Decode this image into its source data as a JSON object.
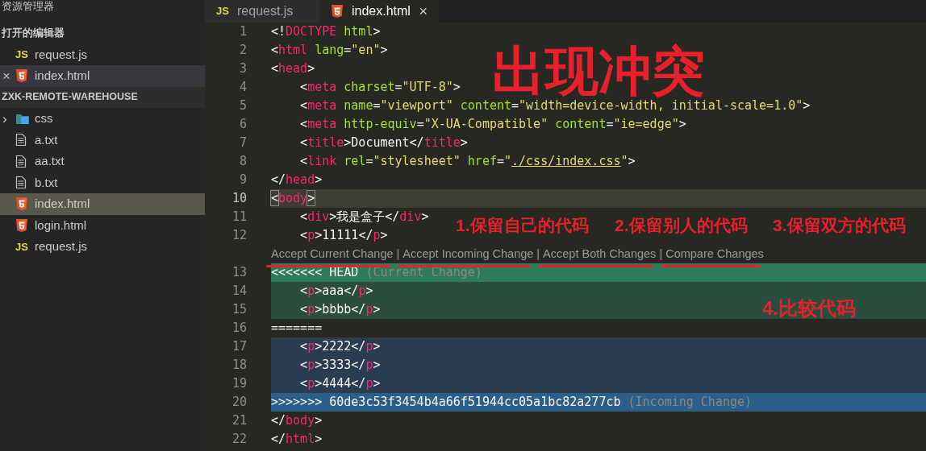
{
  "sidebar": {
    "title": "资源管理器",
    "open_editors": {
      "title": "打开的编辑器",
      "items": [
        {
          "label": "request.js",
          "kind": "js",
          "badge": "JS",
          "selected": false
        },
        {
          "label": "index.html",
          "kind": "html",
          "selected": true,
          "close_glyph": "×"
        }
      ]
    },
    "workspace": {
      "title": "ZXK-REMOTE-WAREHOUSE",
      "items": [
        {
          "label": "css",
          "kind": "folder",
          "expanded": false,
          "chevron": "›",
          "selected": false
        },
        {
          "label": "a.txt",
          "kind": "txt",
          "selected": false
        },
        {
          "label": "aa.txt",
          "kind": "txt",
          "selected": false
        },
        {
          "label": "b.txt",
          "kind": "txt",
          "selected": false
        },
        {
          "label": "index.html",
          "kind": "html",
          "selected": true
        },
        {
          "label": "login.html",
          "kind": "html",
          "selected": false
        },
        {
          "label": "request.js",
          "kind": "js",
          "badge": "JS",
          "selected": false
        }
      ]
    }
  },
  "tabs": [
    {
      "label": "request.js",
      "kind": "js",
      "badge": "JS",
      "selected": false
    },
    {
      "label": "index.html",
      "kind": "html",
      "selected": true,
      "close_glyph": "×"
    }
  ],
  "editor": {
    "lines": [
      {
        "number": "1",
        "kind": "normal",
        "tokens": [
          {
            "kind": "punct",
            "text": "<!"
          },
          {
            "kind": "tag",
            "text": "DOCTYPE"
          },
          {
            "kind": "attr",
            "text": " html"
          },
          {
            "kind": "punct",
            "text": ">"
          }
        ]
      },
      {
        "number": "2",
        "kind": "normal",
        "tokens": [
          {
            "kind": "punct",
            "text": "<"
          },
          {
            "kind": "tag",
            "text": "html"
          },
          {
            "kind": "attr",
            "text": " lang"
          },
          {
            "kind": "punct",
            "text": "="
          },
          {
            "kind": "string",
            "text": "\"en\""
          },
          {
            "kind": "punct",
            "text": ">"
          }
        ]
      },
      {
        "number": "3",
        "kind": "normal",
        "tokens": [
          {
            "kind": "punct",
            "text": "<"
          },
          {
            "kind": "tag",
            "text": "head"
          },
          {
            "kind": "punct",
            "text": ">"
          }
        ]
      },
      {
        "number": "4",
        "kind": "normal",
        "tokens": [
          {
            "kind": "punct",
            "text": "    <"
          },
          {
            "kind": "tag",
            "text": "meta"
          },
          {
            "kind": "attr",
            "text": " charset"
          },
          {
            "kind": "punct",
            "text": "="
          },
          {
            "kind": "string",
            "text": "\"UTF-8\""
          },
          {
            "kind": "punct",
            "text": ">"
          }
        ]
      },
      {
        "number": "5",
        "kind": "normal",
        "tokens": [
          {
            "kind": "punct",
            "text": "    <"
          },
          {
            "kind": "tag",
            "text": "meta"
          },
          {
            "kind": "attr",
            "text": " name"
          },
          {
            "kind": "punct",
            "text": "="
          },
          {
            "kind": "string",
            "text": "\"viewport\""
          },
          {
            "kind": "attr",
            "text": " content"
          },
          {
            "kind": "punct",
            "text": "="
          },
          {
            "kind": "string",
            "text": "\"width=device-width, initial-scale=1.0\""
          },
          {
            "kind": "punct",
            "text": ">"
          }
        ]
      },
      {
        "number": "6",
        "kind": "normal",
        "tokens": [
          {
            "kind": "punct",
            "text": "    <"
          },
          {
            "kind": "tag",
            "text": "meta"
          },
          {
            "kind": "attr",
            "text": " http-equiv"
          },
          {
            "kind": "punct",
            "text": "="
          },
          {
            "kind": "string",
            "text": "\"X-UA-Compatible\""
          },
          {
            "kind": "attr",
            "text": " content"
          },
          {
            "kind": "punct",
            "text": "="
          },
          {
            "kind": "string",
            "text": "\"ie=edge\""
          },
          {
            "kind": "punct",
            "text": ">"
          }
        ]
      },
      {
        "number": "7",
        "kind": "normal",
        "tokens": [
          {
            "kind": "punct",
            "text": "    <"
          },
          {
            "kind": "tag",
            "text": "title"
          },
          {
            "kind": "punct",
            "text": ">"
          },
          {
            "kind": "text",
            "text": "Document"
          },
          {
            "kind": "punct",
            "text": "</"
          },
          {
            "kind": "tag",
            "text": "title"
          },
          {
            "kind": "punct",
            "text": ">"
          }
        ]
      },
      {
        "number": "8",
        "kind": "normal",
        "tokens": [
          {
            "kind": "punct",
            "text": "    <"
          },
          {
            "kind": "tag",
            "text": "link"
          },
          {
            "kind": "attr",
            "text": " rel"
          },
          {
            "kind": "punct",
            "text": "="
          },
          {
            "kind": "string",
            "text": "\"stylesheet\""
          },
          {
            "kind": "attr",
            "text": " href"
          },
          {
            "kind": "punct",
            "text": "="
          },
          {
            "kind": "string",
            "text": "\""
          },
          {
            "kind": "link",
            "text": "./css/index.css"
          },
          {
            "kind": "string",
            "text": "\""
          },
          {
            "kind": "punct",
            "text": ">"
          }
        ]
      },
      {
        "number": "9",
        "kind": "normal",
        "tokens": [
          {
            "kind": "punct",
            "text": "</"
          },
          {
            "kind": "tag",
            "text": "head"
          },
          {
            "kind": "punct",
            "text": ">"
          }
        ]
      },
      {
        "number": "10",
        "kind": "active",
        "tokens": [
          {
            "kind": "bracket",
            "text": "<"
          },
          {
            "kind": "tag",
            "text": "body"
          },
          {
            "kind": "bracket",
            "text": ">"
          }
        ]
      },
      {
        "number": "11",
        "kind": "normal",
        "tokens": [
          {
            "kind": "punct",
            "text": "    <"
          },
          {
            "kind": "tag",
            "text": "div"
          },
          {
            "kind": "punct",
            "text": ">"
          },
          {
            "kind": "text",
            "text": "我是盒子"
          },
          {
            "kind": "punct",
            "text": "</"
          },
          {
            "kind": "tag",
            "text": "div"
          },
          {
            "kind": "punct",
            "text": ">"
          }
        ]
      },
      {
        "number": "12",
        "kind": "normal",
        "tokens": [
          {
            "kind": "punct",
            "text": "    <"
          },
          {
            "kind": "tag",
            "text": "p"
          },
          {
            "kind": "punct",
            "text": ">"
          },
          {
            "kind": "text",
            "text": "11111"
          },
          {
            "kind": "punct",
            "text": "</"
          },
          {
            "kind": "tag",
            "text": "p"
          },
          {
            "kind": "punct",
            "text": ">"
          }
        ],
        "codelens": {
          "separator": "|",
          "actions": [
            {
              "label": "Accept Current Change",
              "underlined": true
            },
            {
              "label": "Accept Incoming Change",
              "underlined": true
            },
            {
              "label": "Accept Both Changes",
              "underlined": true
            },
            {
              "label": "Compare Changes",
              "underlined": true
            }
          ]
        }
      },
      {
        "number": "13",
        "kind": "current-header",
        "tokens": [
          {
            "kind": "text",
            "text": "<<<<<<< HEAD"
          },
          {
            "kind": "comment",
            "text": " (Current Change)"
          }
        ]
      },
      {
        "number": "14",
        "kind": "current",
        "tokens": [
          {
            "kind": "punct",
            "text": "    <"
          },
          {
            "kind": "tag",
            "text": "p"
          },
          {
            "kind": "punct",
            "text": ">"
          },
          {
            "kind": "text",
            "text": "aaa"
          },
          {
            "kind": "punct",
            "text": "</"
          },
          {
            "kind": "tag",
            "text": "p"
          },
          {
            "kind": "punct",
            "text": ">"
          }
        ]
      },
      {
        "number": "15",
        "kind": "current",
        "tokens": [
          {
            "kind": "punct",
            "text": "    <"
          },
          {
            "kind": "tag",
            "text": "p"
          },
          {
            "kind": "punct",
            "text": ">"
          },
          {
            "kind": "text",
            "text": "bbbb"
          },
          {
            "kind": "punct",
            "text": "</"
          },
          {
            "kind": "tag",
            "text": "p"
          },
          {
            "kind": "punct",
            "text": ">"
          }
        ]
      },
      {
        "number": "16",
        "kind": "normal",
        "tokens": [
          {
            "kind": "text",
            "text": "======="
          }
        ]
      },
      {
        "number": "17",
        "kind": "incoming",
        "tokens": [
          {
            "kind": "punct",
            "text": "    <"
          },
          {
            "kind": "tag",
            "text": "p"
          },
          {
            "kind": "punct",
            "text": ">"
          },
          {
            "kind": "text",
            "text": "2222"
          },
          {
            "kind": "punct",
            "text": "</"
          },
          {
            "kind": "tag",
            "text": "p"
          },
          {
            "kind": "punct",
            "text": ">"
          }
        ]
      },
      {
        "number": "18",
        "kind": "incoming",
        "tokens": [
          {
            "kind": "punct",
            "text": "    <"
          },
          {
            "kind": "tag",
            "text": "p"
          },
          {
            "kind": "punct",
            "text": ">"
          },
          {
            "kind": "text",
            "text": "3333"
          },
          {
            "kind": "punct",
            "text": "</"
          },
          {
            "kind": "tag",
            "text": "p"
          },
          {
            "kind": "punct",
            "text": ">"
          }
        ]
      },
      {
        "number": "19",
        "kind": "incoming",
        "tokens": [
          {
            "kind": "punct",
            "text": "    <"
          },
          {
            "kind": "tag",
            "text": "p"
          },
          {
            "kind": "punct",
            "text": ">"
          },
          {
            "kind": "text",
            "text": "4444"
          },
          {
            "kind": "punct",
            "text": "</"
          },
          {
            "kind": "tag",
            "text": "p"
          },
          {
            "kind": "punct",
            "text": ">"
          }
        ]
      },
      {
        "number": "20",
        "kind": "incoming-header",
        "tokens": [
          {
            "kind": "text",
            "text": ">>>>>>> 60de3c53f3454b4a66f51944cc05a1bc82a277cb"
          },
          {
            "kind": "comment",
            "text": " (Incoming Change)"
          }
        ]
      },
      {
        "number": "21",
        "kind": "normal",
        "tokens": [
          {
            "kind": "punct",
            "text": "</"
          },
          {
            "kind": "tag",
            "text": "body"
          },
          {
            "kind": "punct",
            "text": ">"
          }
        ]
      },
      {
        "number": "22",
        "kind": "normal",
        "tokens": [
          {
            "kind": "punct",
            "text": "</"
          },
          {
            "kind": "tag",
            "text": "html"
          },
          {
            "kind": "punct",
            "text": ">"
          }
        ]
      }
    ]
  },
  "annotations": {
    "title": "出现冲突",
    "labels": [
      "1.保留自己的代码",
      "2.保留别人的代码",
      "3.保留双方的代码"
    ],
    "note": "4.比较代码"
  }
}
